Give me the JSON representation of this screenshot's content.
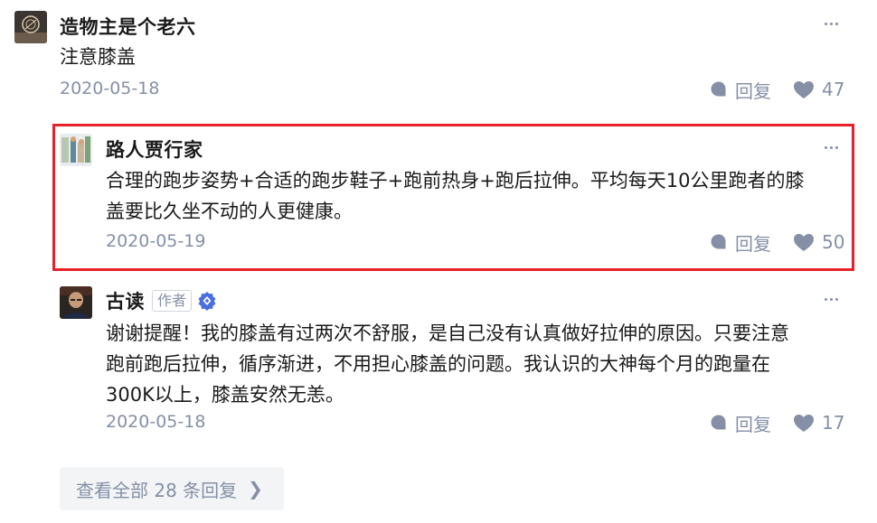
{
  "comments": [
    {
      "author": "造物主是个老六",
      "content_lines": [
        "注意膝盖"
      ],
      "date": "2020-05-18",
      "reply_label": "回复",
      "likes": "47"
    },
    {
      "author": "路人贾行家",
      "content_lines": [
        "合理的跑步姿势+合适的跑步鞋子+跑前热身+跑后拉伸。平均每天10公里跑者的膝",
        "盖要比久坐不动的人更健康。"
      ],
      "date": "2020-05-19",
      "reply_label": "回复",
      "likes": "50"
    },
    {
      "author": "古读",
      "author_tag": "作者",
      "content_lines": [
        "谢谢提醒！我的膝盖有过两次不舒服，是自己没有认真做好拉伸的原因。只要注意",
        "跑前跑后拉伸，循序渐进，不用担心膝盖的问题。我认识的大神每个月的跑量在",
        "300K以上，膝盖安然无恙。"
      ],
      "date": "2020-05-18",
      "reply_label": "回复",
      "likes": "17"
    }
  ],
  "view_all_label": "查看全部 28 条回复",
  "colors": {
    "highlight": "#e8202a",
    "muted": "#8590a6",
    "verify": "#4a6ee0"
  },
  "icons": {
    "more": "more-icon",
    "reply": "comment-bubble-icon",
    "like": "heart-icon",
    "verify": "verified-badge-icon",
    "chevron": "chevron-right-icon"
  }
}
